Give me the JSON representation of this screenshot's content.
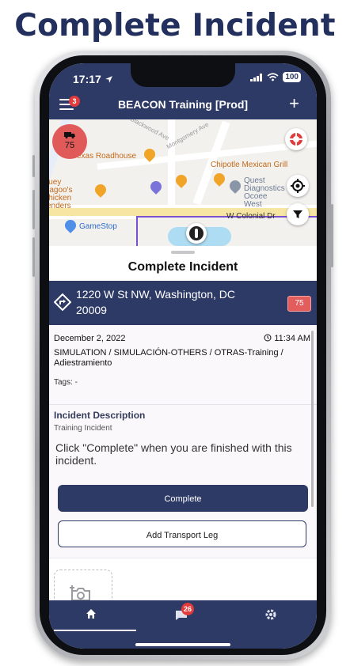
{
  "headline": "Complete Incident",
  "status": {
    "time": "17:17",
    "battery": "100"
  },
  "header": {
    "title": "BEACON Training [Prod]",
    "menu_badge": "3",
    "add_label": "+"
  },
  "map": {
    "unit_marker": "75",
    "streets": [
      "Blackwood Ave",
      "Montgomery Ave",
      "W Colonial Dr"
    ],
    "pois": [
      "Texas Roadhouse",
      "Chipotle Mexican Grill",
      "Quest Diagnostics Ocoee West",
      "Huey Magoo's Chicken Tenders",
      "GameStop"
    ]
  },
  "sheet": {
    "title": "Complete Incident",
    "address": "1220 W St NW, Washington, DC 20009",
    "unit_badge": "75",
    "date": "December 2, 2022",
    "time": "11:34 AM",
    "incident_type": "SIMULATION / SIMULACIÓN-OTHERS / OTRAS-Training / Adiestramiento",
    "tags": "Tags: -",
    "description_heading": "Incident Description",
    "description_text": "Training Incident",
    "instruction": "Click \"Complete\" when you are finished with this incident.",
    "complete_label": "Complete",
    "transport_label": "Add Transport Leg"
  },
  "tabbar": {
    "chat_badge": "26"
  },
  "colors": {
    "navy": "#2e3a66",
    "red": "#e23b3b",
    "headline": "#23305e"
  }
}
